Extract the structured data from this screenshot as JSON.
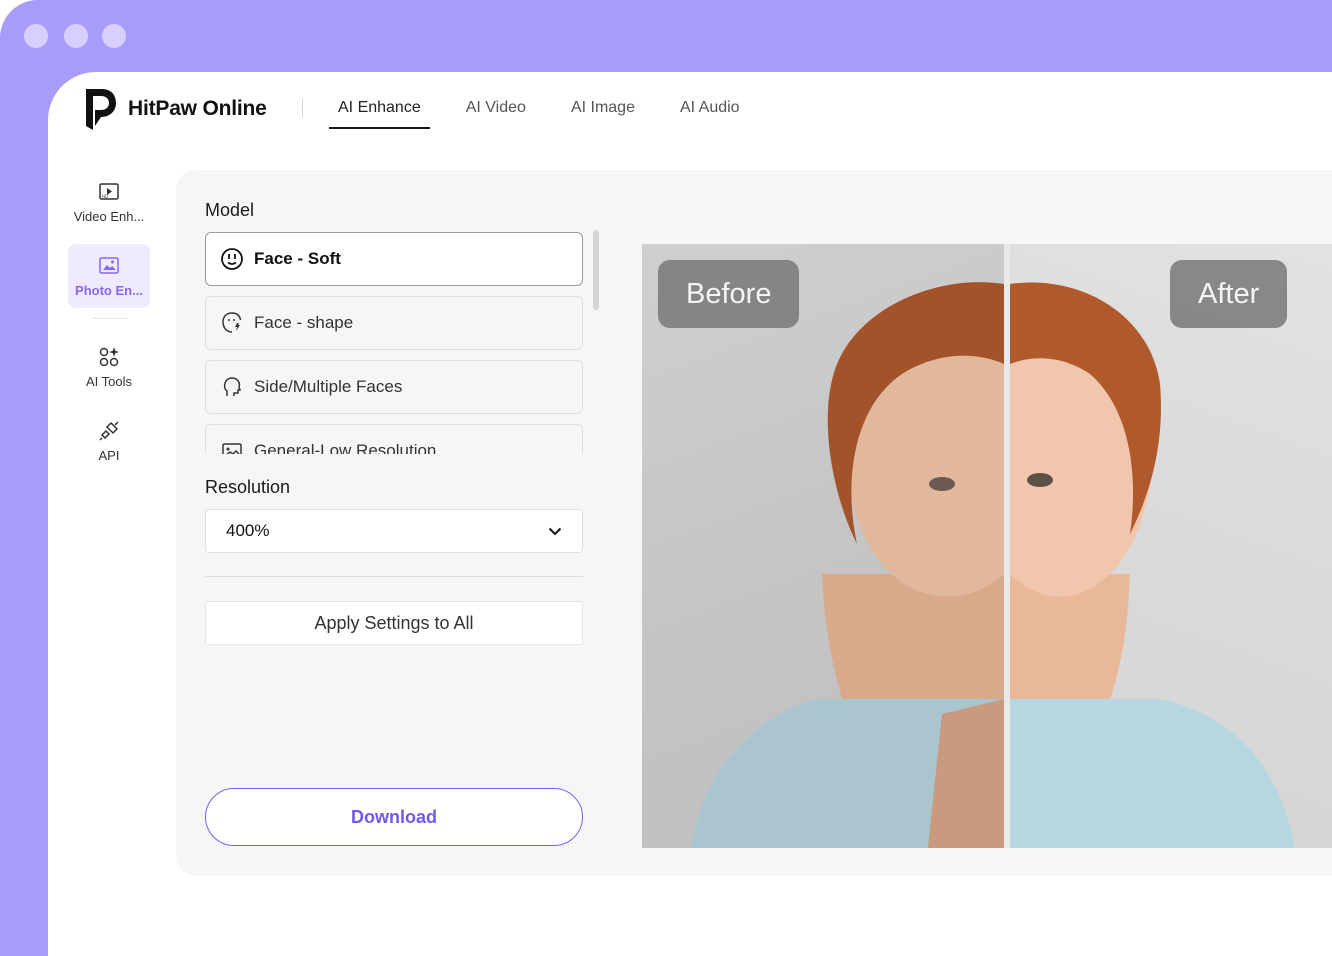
{
  "brand": {
    "name": "HitPaw Online",
    "accent": "#7b61f0",
    "frame_color": "#a79bfb"
  },
  "nav": {
    "items": [
      {
        "label": "AI Enhance",
        "active": true
      },
      {
        "label": "AI Video",
        "active": false
      },
      {
        "label": "AI Image",
        "active": false
      },
      {
        "label": "AI Audio",
        "active": false
      }
    ]
  },
  "sidebar": {
    "items": [
      {
        "label": "Video Enh...",
        "icon": "video-enhance-icon",
        "active": false
      },
      {
        "label": "Photo En...",
        "icon": "photo-enhance-icon",
        "active": true
      },
      {
        "label": "AI Tools",
        "icon": "ai-tools-icon",
        "active": false
      },
      {
        "label": "API",
        "icon": "api-plug-icon",
        "active": false
      }
    ]
  },
  "settings": {
    "model_label": "Model",
    "models": [
      {
        "label": "Face - Soft",
        "icon": "face-soft-icon",
        "selected": true
      },
      {
        "label": "Face - shape",
        "icon": "face-shape-icon",
        "selected": false
      },
      {
        "label": "Side/Multiple Faces",
        "icon": "side-face-icon",
        "selected": false
      },
      {
        "label": "General-Low Resolution",
        "icon": "general-image-icon",
        "selected": false
      }
    ],
    "resolution_label": "Resolution",
    "resolution_value": "400%",
    "apply_label": "Apply Settings to All",
    "download_label": "Download"
  },
  "preview": {
    "before_label": "Before",
    "after_label": "After"
  }
}
